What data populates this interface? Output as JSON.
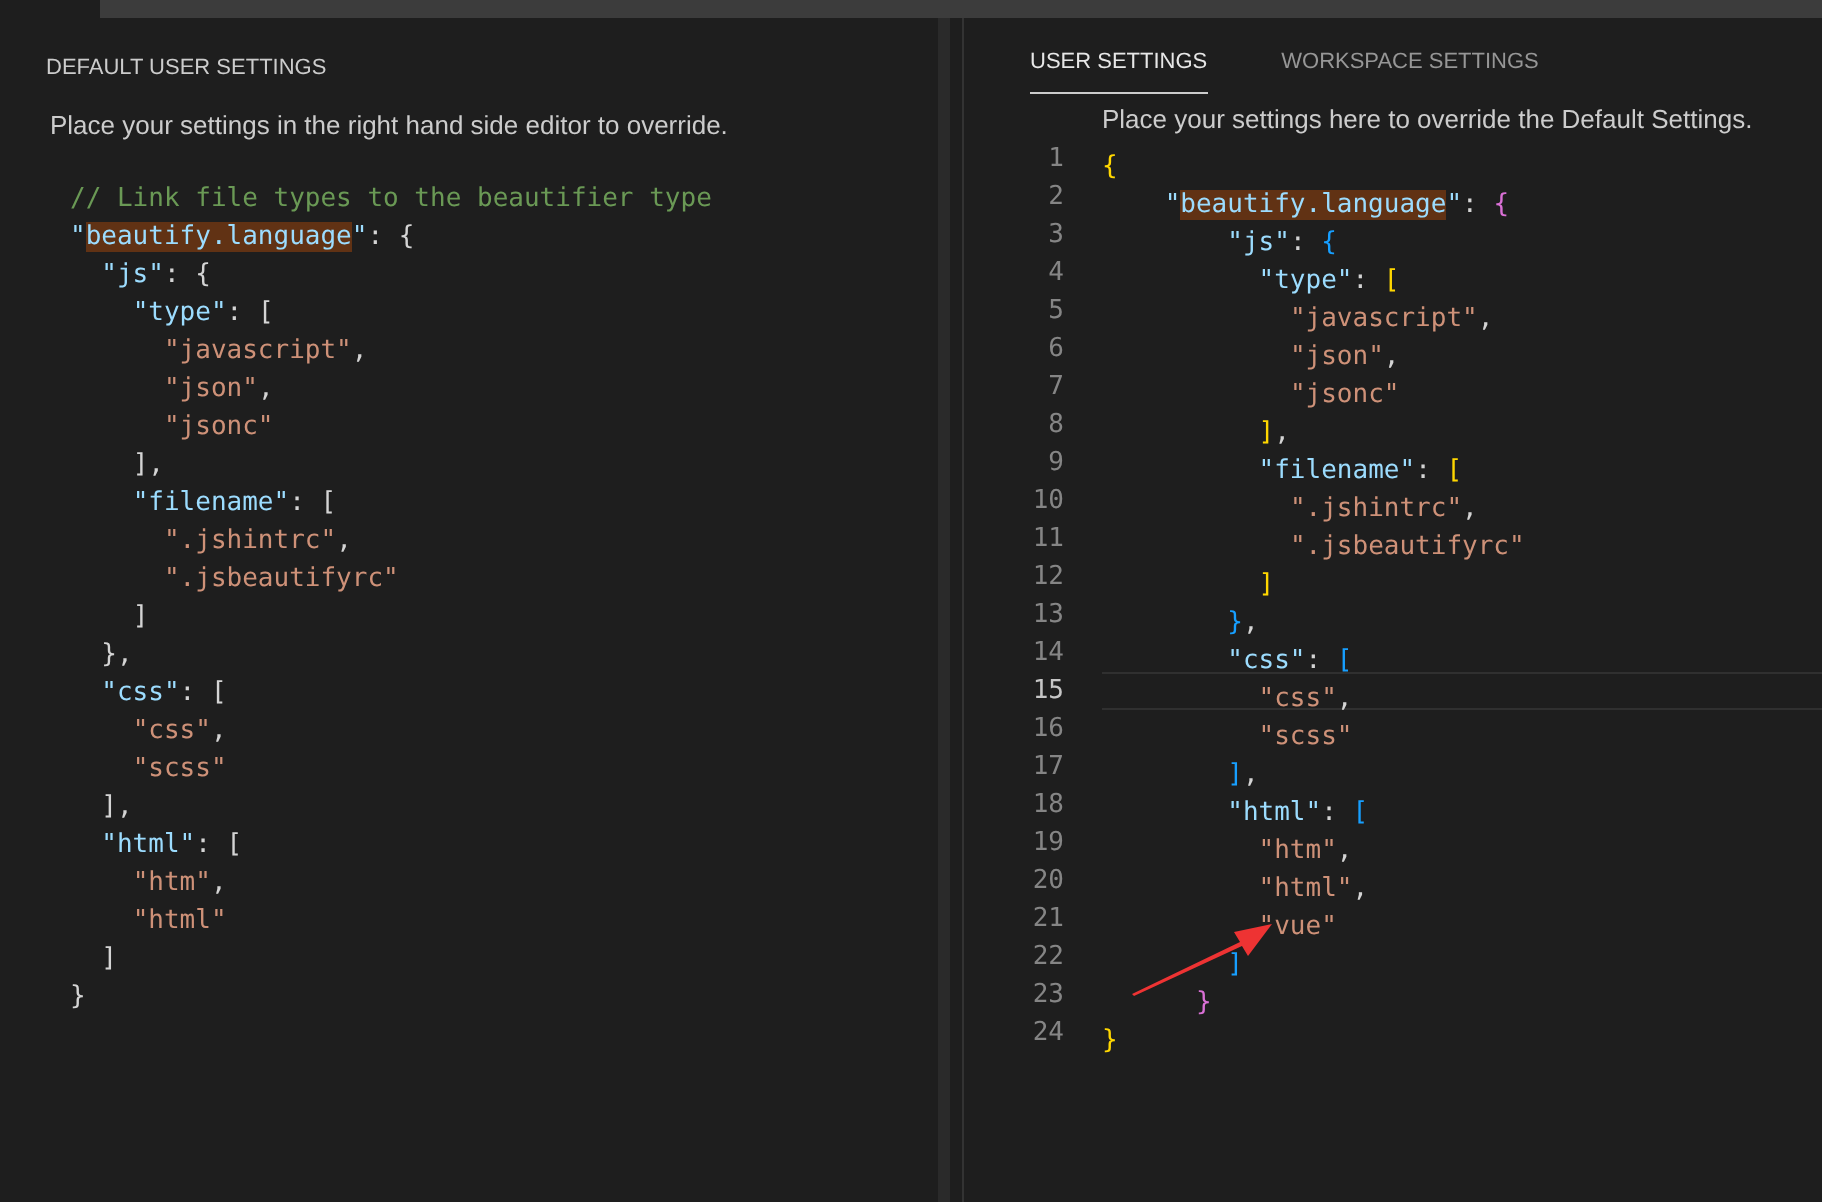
{
  "default_settings": {
    "title": "DEFAULT USER SETTINGS",
    "description": "Place your settings in the right hand side editor to override.",
    "lines": [
      {
        "text": "// Link file types to the beautifier type",
        "highlighted": false
      },
      {
        "text": "\"beautify.language\": {",
        "highlighted": true
      },
      {
        "text": "  \"js\": {",
        "highlighted": false
      },
      {
        "text": "    \"type\": [",
        "highlighted": false
      },
      {
        "text": "      \"javascript\",",
        "highlighted": false
      },
      {
        "text": "      \"json\",",
        "highlighted": false
      },
      {
        "text": "      \"jsonc\"",
        "highlighted": false
      },
      {
        "text": "    ],",
        "highlighted": false
      },
      {
        "text": "    \"filename\": [",
        "highlighted": false
      },
      {
        "text": "      \".jshintrc\",",
        "highlighted": false
      },
      {
        "text": "      \".jsbeautifyrc\"",
        "highlighted": false
      },
      {
        "text": "    ]",
        "highlighted": false
      },
      {
        "text": "  },",
        "highlighted": false
      },
      {
        "text": "  \"css\": [",
        "highlighted": false
      },
      {
        "text": "    \"css\",",
        "highlighted": false
      },
      {
        "text": "    \"scss\"",
        "highlighted": false
      },
      {
        "text": "  ],",
        "highlighted": false
      },
      {
        "text": "  \"html\": [",
        "highlighted": false
      },
      {
        "text": "    \"htm\",",
        "highlighted": false
      },
      {
        "text": "    \"html\"",
        "highlighted": false
      },
      {
        "text": "  ]",
        "highlighted": false
      },
      {
        "text": "}",
        "highlighted": false
      }
    ]
  },
  "user_settings": {
    "tabs": [
      {
        "label": "USER SETTINGS",
        "selected": true
      },
      {
        "label": "WORKSPACE SETTINGS",
        "selected": false
      }
    ],
    "description": "Place your settings here to override the Default Settings.",
    "bracket_colorization": true,
    "lines": [
      {
        "number": "1",
        "text": "{",
        "highlighted": false,
        "current": false
      },
      {
        "number": "2",
        "text": "    \"beautify.language\": {",
        "highlighted": true,
        "current": false
      },
      {
        "number": "3",
        "text": "        \"js\": {",
        "highlighted": false,
        "current": false
      },
      {
        "number": "4",
        "text": "          \"type\": [",
        "highlighted": false,
        "current": false
      },
      {
        "number": "5",
        "text": "            \"javascript\",",
        "highlighted": false,
        "current": false
      },
      {
        "number": "6",
        "text": "            \"json\",",
        "highlighted": false,
        "current": false
      },
      {
        "number": "7",
        "text": "            \"jsonc\"",
        "highlighted": false,
        "current": false
      },
      {
        "number": "8",
        "text": "          ],",
        "highlighted": false,
        "current": false
      },
      {
        "number": "9",
        "text": "          \"filename\": [",
        "highlighted": false,
        "current": false
      },
      {
        "number": "10",
        "text": "            \".jshintrc\",",
        "highlighted": false,
        "current": false
      },
      {
        "number": "11",
        "text": "            \".jsbeautifyrc\"",
        "highlighted": false,
        "current": false
      },
      {
        "number": "12",
        "text": "          ]",
        "highlighted": false,
        "current": false
      },
      {
        "number": "13",
        "text": "        },",
        "highlighted": false,
        "current": false
      },
      {
        "number": "14",
        "text": "        \"css\": [",
        "highlighted": false,
        "current": false
      },
      {
        "number": "15",
        "text": "          \"css\",",
        "highlighted": false,
        "current": true
      },
      {
        "number": "16",
        "text": "          \"scss\"",
        "highlighted": false,
        "current": false
      },
      {
        "number": "17",
        "text": "        ],",
        "highlighted": false,
        "current": false
      },
      {
        "number": "18",
        "text": "        \"html\": [",
        "highlighted": false,
        "current": false
      },
      {
        "number": "19",
        "text": "          \"htm\",",
        "highlighted": false,
        "current": false
      },
      {
        "number": "20",
        "text": "          \"html\",",
        "highlighted": false,
        "current": false
      },
      {
        "number": "21",
        "text": "          \"vue\"",
        "highlighted": false,
        "current": false
      },
      {
        "number": "22",
        "text": "        ]",
        "highlighted": false,
        "current": false
      },
      {
        "number": "23",
        "text": "      }",
        "highlighted": false,
        "current": false
      },
      {
        "number": "24",
        "text": "}",
        "highlighted": false,
        "current": false
      }
    ]
  }
}
